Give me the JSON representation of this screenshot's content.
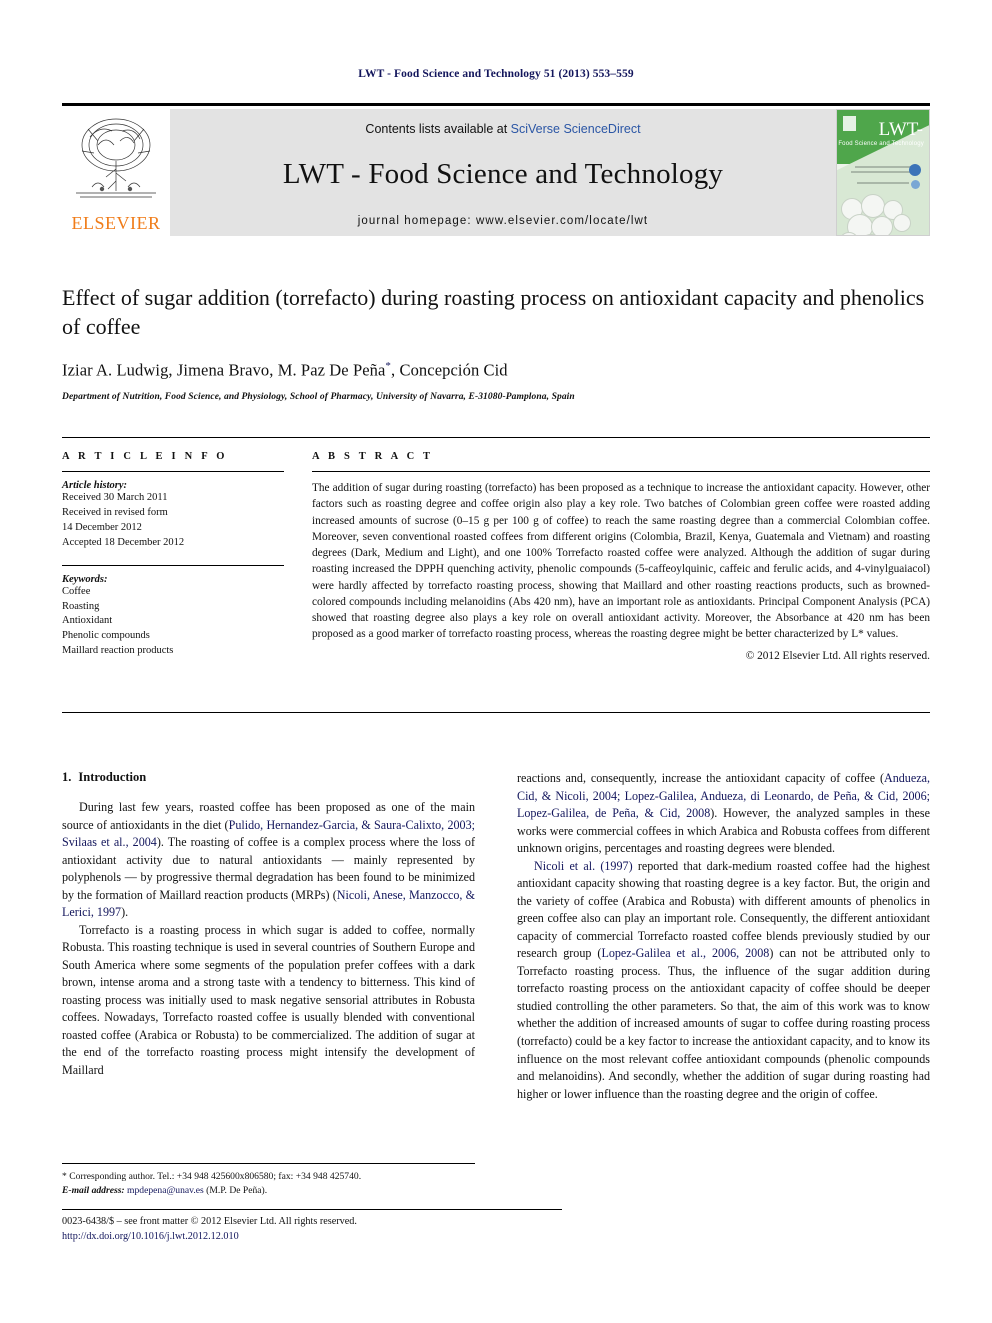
{
  "running_head": "LWT - Food Science and Technology 51 (2013) 553–559",
  "masthead": {
    "contents_prefix": "Contents lists available at ",
    "sciencedirect": "SciVerse ScienceDirect",
    "journal_title": "LWT - Food Science and Technology",
    "homepage": "journal homepage: www.elsevier.com/locate/lwt",
    "publisher_name": "ELSEVIER",
    "cover_title": "LWT-",
    "cover_subtitle": "Food Science and Technology",
    "band_color": "#e3e3e3",
    "link_color": "#2b56a5",
    "cover_green": "#4fa64b",
    "elsevier_orange": "#f07c19"
  },
  "article": {
    "title": "Effect of sugar addition (torrefacto) during roasting process on antioxidant capacity and phenolics of coffee",
    "authors": "Iziar A. Ludwig, Jimena Bravo, M. Paz De Peña",
    "author_suffix": ", Concepción Cid",
    "corresponding_marker": "*",
    "affiliation": "Department of Nutrition, Food Science, and Physiology, School of Pharmacy, University of Navarra, E-31080-Pamplona, Spain"
  },
  "info": {
    "heading": "A R T I C L E   I N F O",
    "history_label": "Article history:",
    "history": [
      "Received 30 March 2011",
      "Received in revised form",
      "14 December 2012",
      "Accepted 18 December 2012"
    ],
    "keywords_label": "Keywords:",
    "keywords": [
      "Coffee",
      "Roasting",
      "Antioxidant",
      "Phenolic compounds",
      "Maillard reaction products"
    ]
  },
  "abstract": {
    "heading": "A B S T R A C T",
    "text": "The addition of sugar during roasting (torrefacto) has been proposed as a technique to increase the antioxidant capacity. However, other factors such as roasting degree and coffee origin also play a key role. Two batches of Colombian green coffee were roasted adding increased amounts of sucrose (0–15 g per 100 g of coffee) to reach the same roasting degree than a commercial Colombian coffee. Moreover, seven conventional roasted coffees from different origins (Colombia, Brazil, Kenya, Guatemala and Vietnam) and roasting degrees (Dark, Medium and Light), and one 100% Torrefacto roasted coffee were analyzed. Although the addition of sugar during roasting increased the DPPH quenching activity, phenolic compounds (5-caffeoylquinic, caffeic and ferulic acids, and 4-vinylguaiacol) were hardly affected by torrefacto roasting process, showing that Maillard and other roasting reactions products, such as browned-colored compounds including melanoidins (Abs 420 nm), have an important role as antioxidants. Principal Component Analysis (PCA) showed that roasting degree also plays a key role on overall antioxidant activity. Moreover, the Absorbance at 420 nm has been proposed as a good marker of torrefacto roasting process, whereas the roasting degree might be better characterized by L* values.",
    "copyright": "© 2012 Elsevier Ltd. All rights reserved."
  },
  "introduction": {
    "number": "1.",
    "heading": "Introduction",
    "left_p1_a": "During last few years, roasted coffee has been proposed as one of the main source of antioxidants in the diet (",
    "left_p1_cite1": "Pulido, Hernandez-Garcia, & Saura-Calixto, 2003; Svilaas et al., 2004",
    "left_p1_b": "). The roasting of coffee is a complex process where the loss of antioxidant activity due to natural antioxidants — mainly represented by polyphenols — by progressive thermal degradation has been found to be minimized by the formation of Maillard reaction products (MRPs) (",
    "left_p1_cite2": "Nicoli, Anese, Manzocco, & Lerici, 1997",
    "left_p1_c": ").",
    "left_p2": "Torrefacto is a roasting process in which sugar is added to coffee, normally Robusta. This roasting technique is used in several countries of Southern Europe and South America where some segments of the population prefer coffees with a dark brown, intense aroma and a strong taste with a tendency to bitterness. This kind of roasting process was initially used to mask negative sensorial attributes in Robusta coffees. Nowadays, Torrefacto roasted coffee is usually blended with conventional roasted coffee (Arabica or Robusta) to be commercialized. The addition of sugar at the end of the torrefacto roasting process might intensify the development of Maillard",
    "right_p1_a": "reactions and, consequently, increase the antioxidant capacity of coffee (",
    "right_p1_cite1": "Andueza, Cid, & Nicoli, 2004; Lopez-Galilea, Andueza, di Leonardo, de Peña, & Cid, 2006; Lopez-Galilea, de Peña, & Cid, 2008",
    "right_p1_b": "). However, the analyzed samples in these works were commercial coffees in which Arabica and Robusta coffees from different unknown origins, percentages and roasting degrees were blended.",
    "right_p2_cite1": "Nicoli et al. (1997)",
    "right_p2_a": " reported that dark-medium roasted coffee had the highest antioxidant capacity showing that roasting degree is a key factor. But, the origin and the variety of coffee (Arabica and Robusta) with different amounts of phenolics in green coffee also can play an important role. Consequently, the different antioxidant capacity of commercial Torrefacto roasted coffee blends previously studied by our research group (",
    "right_p2_cite2": "Lopez-Galilea et al., 2006, 2008",
    "right_p2_b": ") can not be attributed only to Torrefacto roasting process. Thus, the influence of the sugar addition during torrefacto roasting process on the antioxidant capacity of coffee should be deeper studied controlling the other parameters. So that, the aim of this work was to know whether the addition of increased amounts of sugar to coffee during roasting process (torrefacto) could be a key factor to increase the antioxidant capacity, and to know its influence on the most relevant coffee antioxidant compounds (phenolic compounds and melanoidins). And secondly, whether the addition of sugar during roasting had higher or lower influence than the roasting degree and the origin of coffee."
  },
  "footnote": {
    "marker": "*",
    "corresponding": " Corresponding author. Tel.: +34 948 425600x806580; fax: +34 948 425740.",
    "email_label": "E-mail address:",
    "email": "mpdepena@unav.es",
    "email_owner": " (M.P. De Peña)."
  },
  "bottom": {
    "issn": "0023-6438/$ – see front matter © 2012 Elsevier Ltd. All rights reserved.",
    "doi": "http://dx.doi.org/10.1016/j.lwt.2012.12.010"
  }
}
